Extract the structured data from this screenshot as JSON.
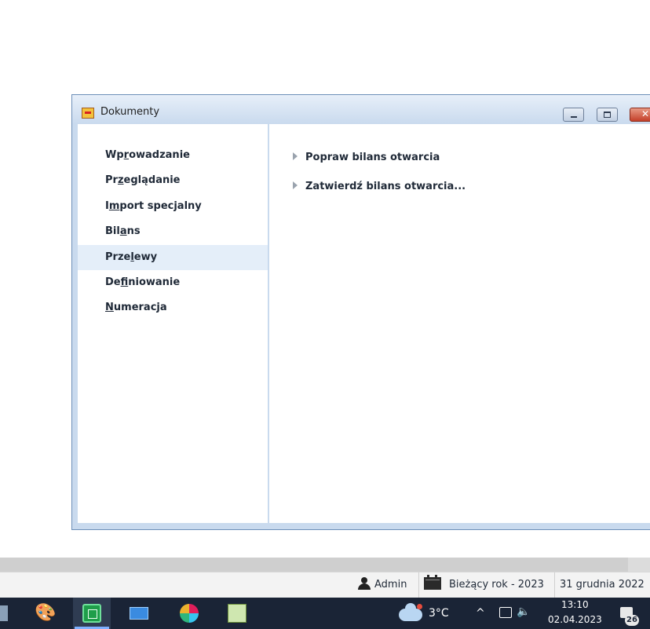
{
  "window": {
    "title": "Dokumenty"
  },
  "nav": {
    "items": [
      {
        "pre": "Wp",
        "u": "r",
        "post": "owadzanie"
      },
      {
        "pre": "Pr",
        "u": "z",
        "post": "eglądanie"
      },
      {
        "pre": "I",
        "u": "m",
        "post": "port specjalny"
      },
      {
        "pre": "Bil",
        "u": "a",
        "post": "ns"
      },
      {
        "pre": "Prze",
        "u": "l",
        "post": "ewy"
      },
      {
        "pre": "De",
        "u": "f",
        "post": "iniowanie"
      },
      {
        "pre": "",
        "u": "N",
        "post": "umeracja"
      }
    ],
    "selected_index": 4
  },
  "actions": [
    {
      "label": "Popraw bilans otwarcia"
    },
    {
      "label": "Zatwierdź bilans otwarcia..."
    }
  ],
  "status": {
    "user": "Admin",
    "period": "Bieżący rok - 2023",
    "date": "31 grudnia 2022"
  },
  "taskbar": {
    "temperature": "3°C",
    "time": "13:10",
    "date": "02.04.2023",
    "notifications": "26"
  },
  "colors": {
    "selected_bg": "#e4eef9",
    "window_frame": "#c9daee",
    "taskbar_bg": "#1a2436"
  }
}
